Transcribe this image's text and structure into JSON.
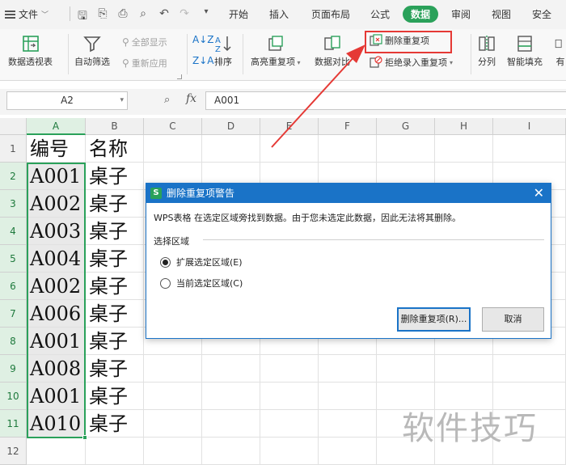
{
  "menubar": {
    "file_label": "文件",
    "tabs": [
      "开始",
      "插入",
      "页面布局",
      "公式",
      "数据",
      "审阅",
      "视图",
      "安全"
    ],
    "active_tab": "数据"
  },
  "ribbon": {
    "pivot": "数据透视表",
    "autofilter": "自动筛选",
    "show_all": "全部显示",
    "reapply": "重新应用",
    "sort": "排序",
    "highlight_dup": "高亮重复项",
    "data_compare": "数据对比",
    "remove_dup": "删除重复项",
    "reject_dup": "拒绝录入重复项",
    "split": "分列",
    "smart_fill": "智能填充",
    "more": "有"
  },
  "formula_bar": {
    "cell_ref": "A2",
    "fx": "fx",
    "value": "A001"
  },
  "sheet": {
    "columns": [
      "A",
      "B",
      "C",
      "D",
      "E",
      "F",
      "G",
      "H",
      "I"
    ],
    "rows": [
      [
        "编号",
        "名称"
      ],
      [
        "A001",
        "桌子"
      ],
      [
        "A002",
        "桌子"
      ],
      [
        "A003",
        "桌子"
      ],
      [
        "A004",
        "桌子"
      ],
      [
        "A002",
        "桌子"
      ],
      [
        "A006",
        "桌子"
      ],
      [
        "A001",
        "桌子"
      ],
      [
        "A008",
        "桌子"
      ],
      [
        "A001",
        "桌子"
      ],
      [
        "A010",
        "桌子"
      ],
      [
        "",
        ""
      ]
    ],
    "row_numbers": [
      "1",
      "2",
      "3",
      "4",
      "5",
      "6",
      "7",
      "8",
      "9",
      "10",
      "11",
      "12"
    ]
  },
  "dialog": {
    "title": "删除重复项警告",
    "app_icon": "S",
    "message": "WPS表格 在选定区域旁找到数据。由于您未选定此数据，因此无法将其删除。",
    "group_label": "选择区域",
    "option_expand": "扩展选定区域(E)",
    "option_current": "当前选定区域(C)",
    "selected_option": "expand",
    "btn_remove": "删除重复项(R)...",
    "btn_cancel": "取消"
  },
  "watermark": "软件技巧",
  "colors": {
    "accent_green": "#2aa15a",
    "dialog_blue": "#1a73c7",
    "highlight_red": "#e53935"
  }
}
